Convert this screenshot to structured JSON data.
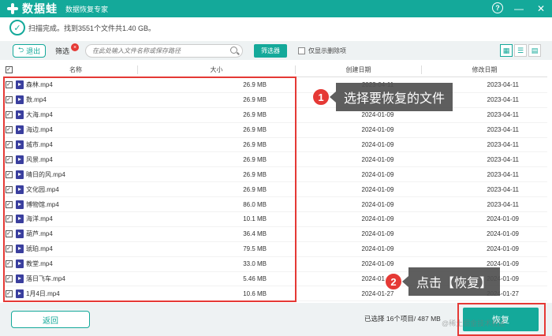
{
  "app": {
    "logo_text": "数据蛙",
    "subtitle": "数据恢复专家",
    "help_label": "?",
    "minimize_label": "—",
    "close_label": "✕"
  },
  "status": {
    "text": "扫描完成。找到3551个文件共1.40 GB。"
  },
  "toolbar": {
    "exit_label": "退出",
    "filter_label": "筛选",
    "filter_badge": "×",
    "search_placeholder": "在此处输入文件名称或保存路径",
    "filter_button": "筛选器",
    "only_deleted_label": "仅显示删除项"
  },
  "table": {
    "headers": {
      "name": "名称",
      "size": "大小",
      "created": "创建日期",
      "modified": "修改日期"
    },
    "rows": [
      {
        "name": "森林.mp4",
        "size": "26.9 MB",
        "created": "2023-04-11",
        "modified": "2023-04-11"
      },
      {
        "name": "数.mp4",
        "size": "26.9 MB",
        "created": "2023-04-11",
        "modified": "2023-04-11"
      },
      {
        "name": "大海.mp4",
        "size": "26.9 MB",
        "created": "2024-01-09",
        "modified": "2023-04-11"
      },
      {
        "name": "海边.mp4",
        "size": "26.9 MB",
        "created": "2024-01-09",
        "modified": "2023-04-11"
      },
      {
        "name": "城市.mp4",
        "size": "26.9 MB",
        "created": "2024-01-09",
        "modified": "2023-04-11"
      },
      {
        "name": "风景.mp4",
        "size": "26.9 MB",
        "created": "2024-01-09",
        "modified": "2023-04-11"
      },
      {
        "name": "晴日的风.mp4",
        "size": "26.9 MB",
        "created": "2024-01-09",
        "modified": "2023-04-11"
      },
      {
        "name": "文化园.mp4",
        "size": "26.9 MB",
        "created": "2024-01-09",
        "modified": "2023-04-11"
      },
      {
        "name": "博物馆.mp4",
        "size": "86.0 MB",
        "created": "2024-01-09",
        "modified": "2023-04-11"
      },
      {
        "name": "海洋.mp4",
        "size": "10.1 MB",
        "created": "2024-01-09",
        "modified": "2024-01-09"
      },
      {
        "name": "葫芦.mp4",
        "size": "36.4 MB",
        "created": "2024-01-09",
        "modified": "2024-01-09"
      },
      {
        "name": "琥珀.mp4",
        "size": "79.5 MB",
        "created": "2024-01-09",
        "modified": "2024-01-09"
      },
      {
        "name": "教堂.mp4",
        "size": "33.0 MB",
        "created": "2024-01-09",
        "modified": "2024-01-09"
      },
      {
        "name": "落日飞车.mp4",
        "size": "5.46 MB",
        "created": "2024-01-09",
        "modified": "2024-01-09"
      },
      {
        "name": "1月4日.mp4",
        "size": "10.6 MB",
        "created": "2024-01-27",
        "modified": "2024-01-27"
      }
    ]
  },
  "callouts": {
    "step1_num": "1",
    "step1_text": "选择要恢复的文件",
    "step2_num": "2",
    "step2_text": "点击【恢复】"
  },
  "bottom": {
    "back_label": "返回",
    "selection_summary": "已选择 16个项目/ 487 MB",
    "recover_label": "恢复",
    "watermark": "@稀土掘金技术社区"
  },
  "colors": {
    "accent": "#14a99a",
    "highlight": "#e53935"
  }
}
